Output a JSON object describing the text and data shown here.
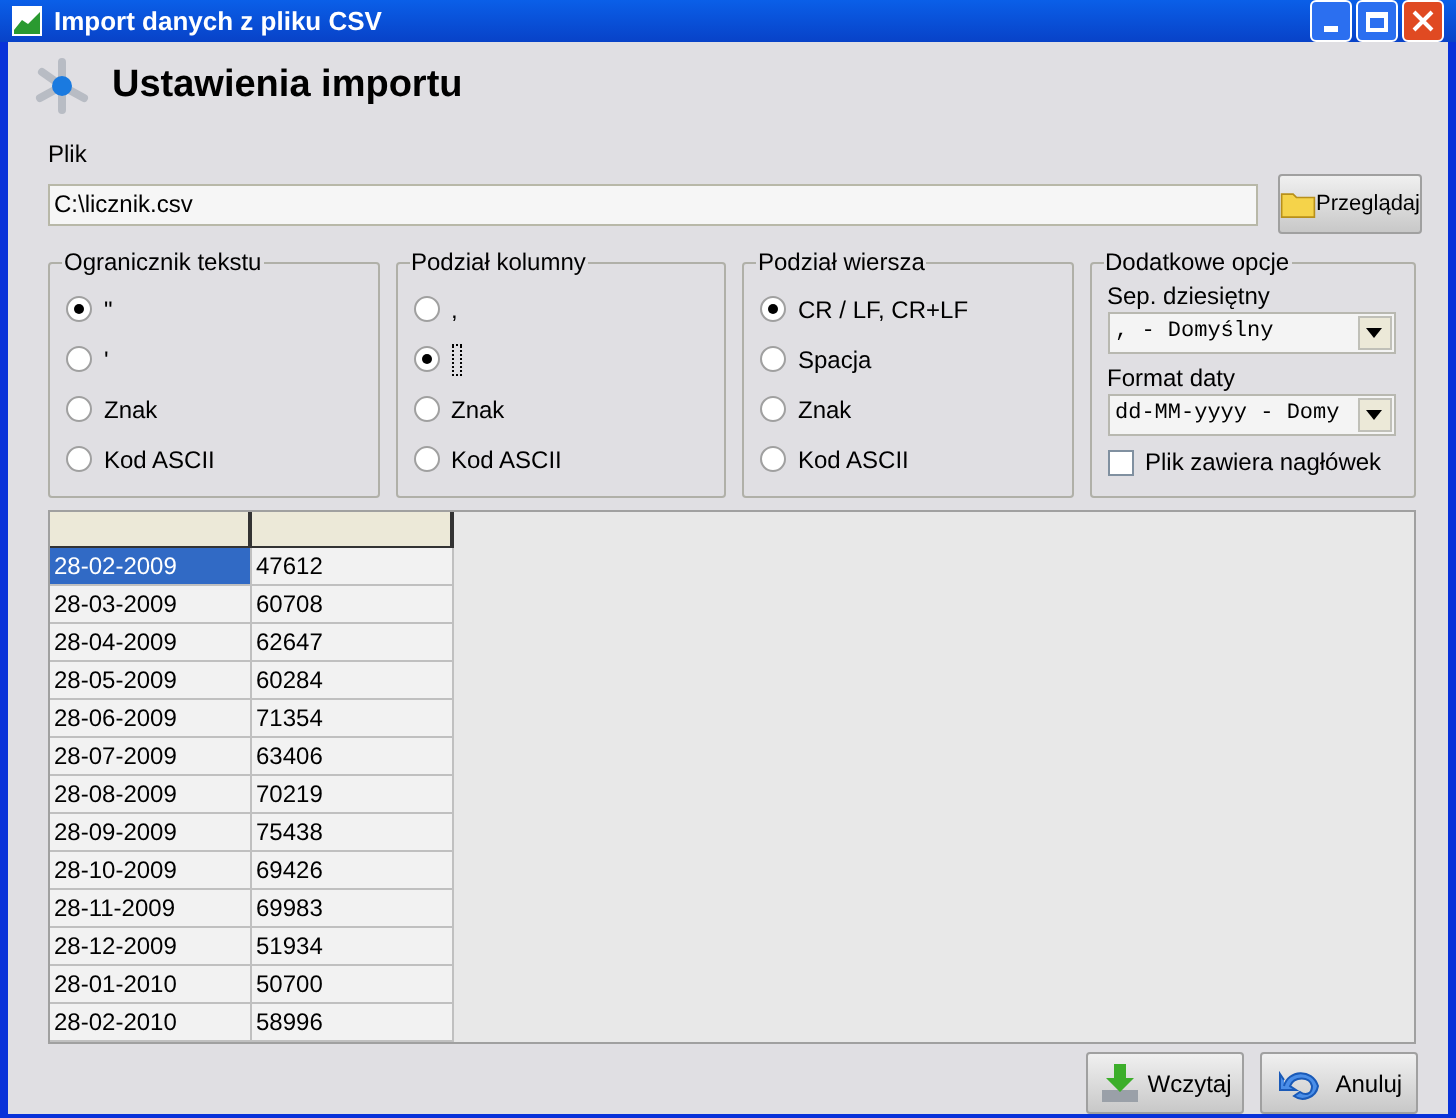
{
  "window": {
    "title": "Import danych z pliku CSV"
  },
  "header": {
    "title": "Ustawienia importu"
  },
  "file": {
    "label": "Plik",
    "value": "C:\\licznik.csv",
    "browse_button": "Przeglądaj"
  },
  "groups": [
    {
      "title": "Ogranicznik tekstu",
      "options": [
        {
          "label": "\"",
          "selected": true
        },
        {
          "label": "'",
          "selected": false
        },
        {
          "label": "Znak",
          "selected": false
        },
        {
          "label": "Kod ASCII",
          "selected": false
        }
      ]
    },
    {
      "title": "Podział kolumny",
      "options": [
        {
          "label": ",",
          "selected": false
        },
        {
          "focused": true,
          "selected": true
        },
        {
          "label": "Znak",
          "selected": false
        },
        {
          "label": "Kod ASCII",
          "selected": false
        }
      ]
    },
    {
      "title": "Podział wiersza",
      "options": [
        {
          "label": "CR / LF, CR+LF",
          "selected": true
        },
        {
          "label": "Spacja",
          "selected": false
        },
        {
          "label": "Znak",
          "selected": false
        },
        {
          "label": "Kod ASCII",
          "selected": false
        }
      ]
    }
  ],
  "extra": {
    "title": "Dodatkowe opcje",
    "decimal_label": "Sep. dziesiętny",
    "decimal_value": ", - Domyślny",
    "date_label": "Format daty",
    "date_value": "dd-MM-yyyy - Domy",
    "header_checkbox": {
      "label": "Plik zawiera nagłówek",
      "checked": false
    }
  },
  "table": {
    "rows": [
      {
        "cells": [
          "28-02-2009",
          "47612"
        ],
        "selected": true
      },
      {
        "cells": [
          "28-03-2009",
          "60708"
        ],
        "selected": false
      },
      {
        "cells": [
          "28-04-2009",
          "62647"
        ],
        "selected": false
      },
      {
        "cells": [
          "28-05-2009",
          "60284"
        ],
        "selected": false
      },
      {
        "cells": [
          "28-06-2009",
          "71354"
        ],
        "selected": false
      },
      {
        "cells": [
          "28-07-2009",
          "63406"
        ],
        "selected": false
      },
      {
        "cells": [
          "28-08-2009",
          "70219"
        ],
        "selected": false
      },
      {
        "cells": [
          "28-09-2009",
          "75438"
        ],
        "selected": false
      },
      {
        "cells": [
          "28-10-2009",
          "69426"
        ],
        "selected": false
      },
      {
        "cells": [
          "28-11-2009",
          "69983"
        ],
        "selected": false
      },
      {
        "cells": [
          "28-12-2009",
          "51934"
        ],
        "selected": false
      },
      {
        "cells": [
          "28-01-2010",
          "50700"
        ],
        "selected": false
      },
      {
        "cells": [
          "28-02-2010",
          "58996"
        ],
        "selected": false
      }
    ]
  },
  "buttons": [
    "Wczytaj",
    "Anuluj"
  ]
}
